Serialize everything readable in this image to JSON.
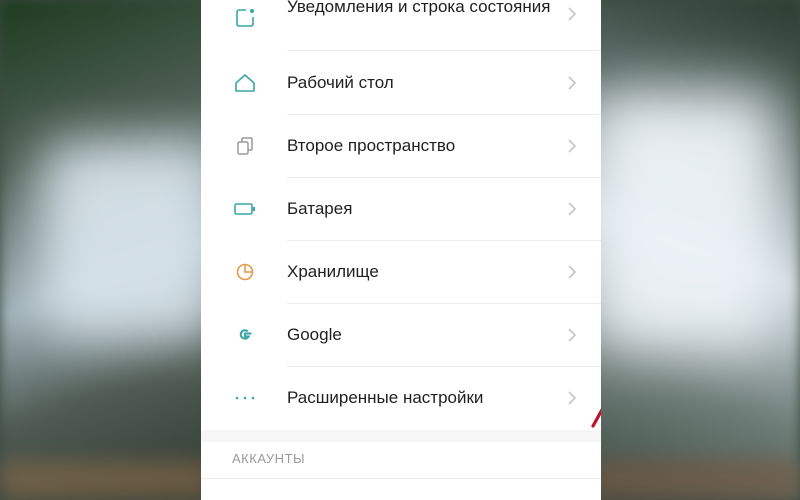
{
  "settings": {
    "items": [
      {
        "label": "Уведомления и строка состояния",
        "icon": "notification-icon"
      },
      {
        "label": "Рабочий стол",
        "icon": "home-icon"
      },
      {
        "label": "Второе пространство",
        "icon": "second-space-icon"
      },
      {
        "label": "Батарея",
        "icon": "battery-icon"
      },
      {
        "label": "Хранилище",
        "icon": "storage-icon"
      },
      {
        "label": "Google",
        "icon": "google-icon"
      },
      {
        "label": "Расширенные настройки",
        "icon": "more-icon"
      }
    ],
    "section_header": "АККАУНТЫ"
  },
  "annotation": {
    "arrow_color": "#c0112a"
  },
  "colors": {
    "icon_teal": "#3aa6a6",
    "icon_orange": "#e49a4a",
    "chevron": "#c4c4c4"
  }
}
